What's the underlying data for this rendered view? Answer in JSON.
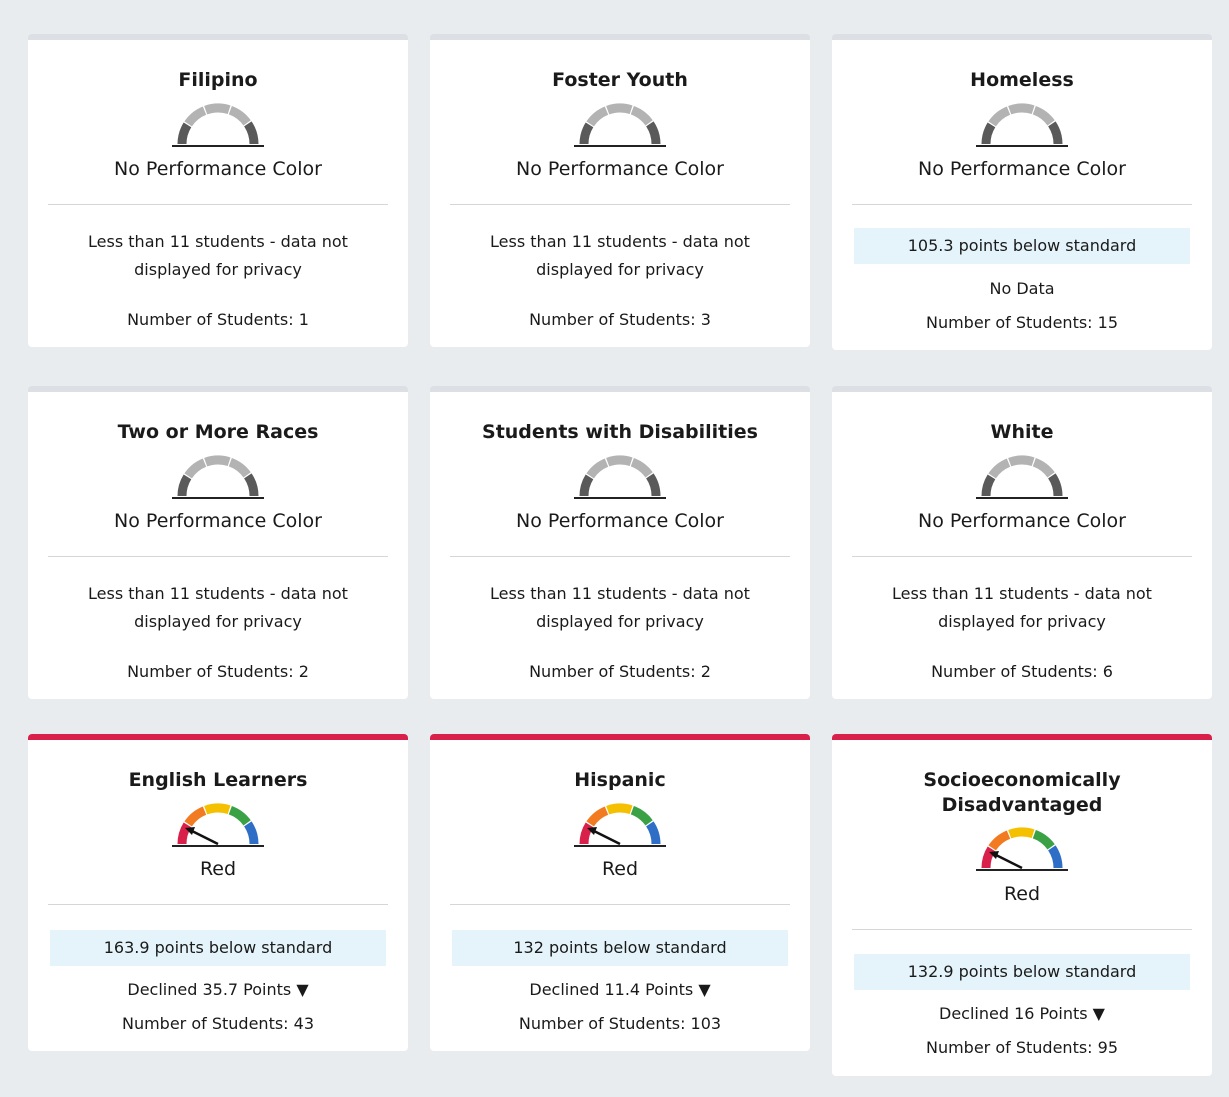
{
  "cards": [
    {
      "title": "Filipino",
      "color_label": "No Performance Color",
      "note": "Less than 11 students - data not displayed for privacy",
      "students": "Number of Students: 1"
    },
    {
      "title": "Foster Youth",
      "color_label": "No Performance Color",
      "note": "Less than 11 students - data not displayed for privacy",
      "students": "Number of Students: 3"
    },
    {
      "title": "Homeless",
      "color_label": "No Performance Color",
      "status": "105.3 points below standard",
      "change": "No Data",
      "students": "Number of Students: 15"
    },
    {
      "title": "Two or More Races",
      "color_label": "No Performance Color",
      "note": "Less than 11 students - data not displayed for privacy",
      "students": "Number of Students: 2"
    },
    {
      "title": "Students with Disabilities",
      "color_label": "No Performance Color",
      "note": "Less than 11 students - data not displayed for privacy",
      "students": "Number of Students: 2"
    },
    {
      "title": "White",
      "color_label": "No Performance Color",
      "note": "Less than 11 students - data not displayed for privacy",
      "students": "Number of Students: 6"
    },
    {
      "title": "English Learners",
      "color_label": "Red",
      "status": "163.9 points below standard",
      "change": "Declined 35.7 Points ▼",
      "students": "Number of Students: 43"
    },
    {
      "title": "Hispanic",
      "color_label": "Red",
      "status": "132 points below standard",
      "change": "Declined 11.4 Points ▼",
      "students": "Number of Students: 103"
    },
    {
      "title": "Socioeconomically Disadvantaged",
      "color_label": "Red",
      "status": "132.9 points below standard",
      "change": "Declined 16 Points ▼",
      "students": "Number of Students: 95"
    }
  ],
  "colors": {
    "gauge_gray_dark": "#5a5a5a",
    "gauge_gray_light": "#b3b3b3",
    "gauge_red": "#d9204a",
    "gauge_orange": "#f27b22",
    "gauge_yellow": "#f5c000",
    "gauge_green": "#3aa245",
    "gauge_blue": "#2f6ec7",
    "status_box": "#e4f4fa",
    "card_top_red": "#d9204a"
  }
}
